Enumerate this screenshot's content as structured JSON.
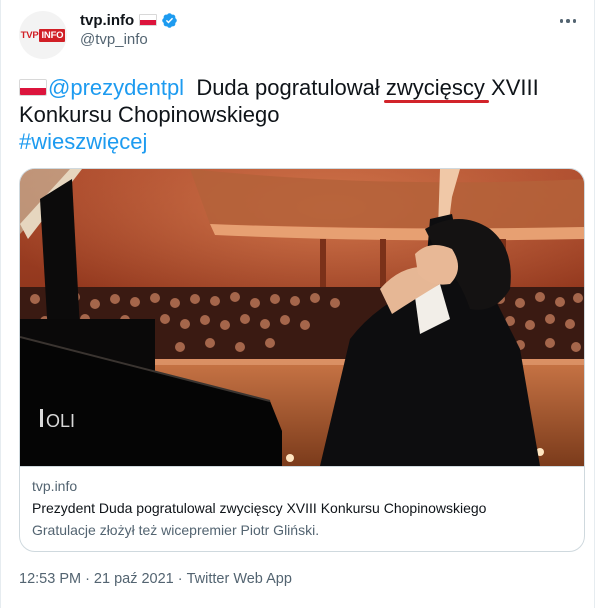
{
  "author": {
    "display_name": "tvp.info",
    "handle": "@tvp_info",
    "avatar_logo_left": "TVP",
    "avatar_logo_right": "INFO"
  },
  "tweet": {
    "mention": "@prezydentpl",
    "text_before_highlight": "Duda pogratulował ",
    "highlighted_word": "zwycięscy",
    "text_after_highlight": " XVIII",
    "line2": "Konkursu Chopinowskiego",
    "hashtag": "#wieszwięcej"
  },
  "card": {
    "image_watermark": "OLI",
    "domain": "tvp.info",
    "title": "Prezydent Duda pogratulowal zwycięscy XVIII Konkursu Chopinowskiego",
    "description": "Gratulacje złożył też wicepremier Piotr Gliński."
  },
  "meta": {
    "time": "12:53 PM",
    "separator": "·",
    "date": "21 paź 2021",
    "app": "Twitter Web App"
  },
  "colors": {
    "link": "#1d9bf0",
    "highlight_underline": "#d2232a",
    "secondary_text": "#536471",
    "logo_red": "#d11f26"
  },
  "icons": [
    "verified-badge-icon",
    "poland-flag-icon",
    "more-options-icon"
  ]
}
